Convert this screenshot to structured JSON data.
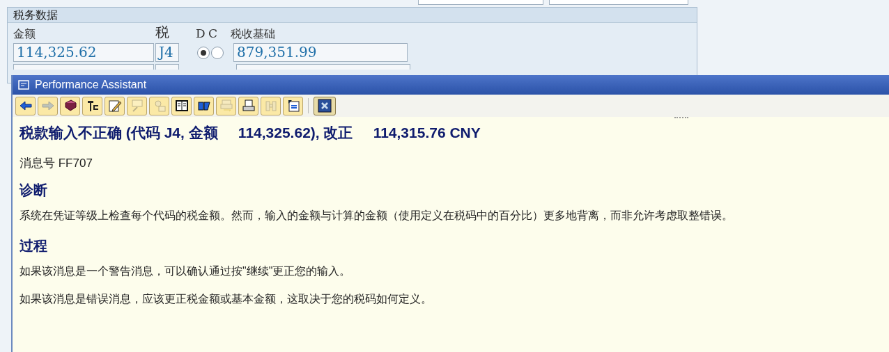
{
  "tax_section": {
    "title": "税务数据",
    "columns": [
      "金额",
      "税",
      "D",
      "C",
      "税收基础"
    ],
    "rows": [
      {
        "amount": "114,325.62",
        "tax_code": "J4",
        "debit": {
          "selected": true
        },
        "credit": {
          "selected": false
        },
        "tax_base": "879,351.99"
      }
    ]
  },
  "assistant": {
    "title": "Performance Assistant",
    "toolbar": [
      {
        "disabled": false
      },
      {
        "disabled": true
      },
      {
        "disabled": false
      },
      {
        "disabled": false
      },
      {
        "disabled": false
      },
      {
        "disabled": true
      },
      {
        "disabled": true
      },
      {
        "disabled": false
      },
      {
        "disabled": false
      },
      {
        "disabled": true
      },
      {
        "disabled": false
      },
      {
        "disabled": true
      },
      {
        "disabled": false
      }
    ],
    "message_title": "税款输入不正确 (代码 J4, 金额     114,325.62), 改正     114,315.76 CNY",
    "message_number": "消息号 FF707",
    "sections": [
      {
        "heading": "诊断",
        "paragraphs": [
          "系统在凭证等级上检查每个代码的税金额。然而，输入的金额与计算的金额（使用定义在税码中的百分比）更多地背离，而非允许考虑取整错误。"
        ]
      },
      {
        "heading": "过程",
        "paragraphs": [
          "如果该消息是一个警告消息，可以确认通过按\"继续\"更正您的输入。",
          "如果该消息是错误消息，应该更正税金额或基本金额，这取决于您的税码如何定义。"
        ]
      }
    ]
  }
}
